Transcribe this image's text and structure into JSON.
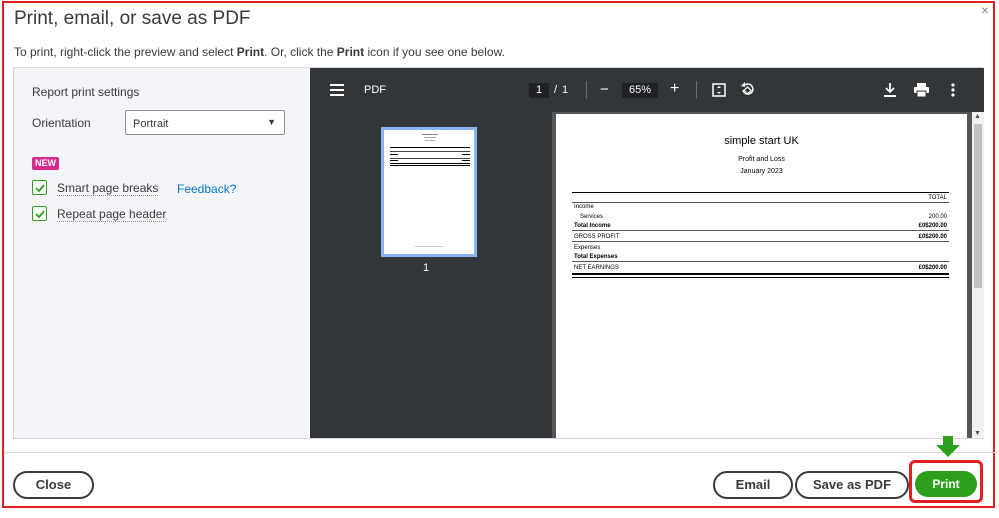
{
  "dialog": {
    "title": "Print, email, or save as PDF",
    "close_glyph": "×",
    "instruction_pre": "To print, right-click the preview and select ",
    "instruction_bold1": "Print",
    "instruction_mid": ". Or, click the ",
    "instruction_bold2": "Print",
    "instruction_post": " icon if you see one below."
  },
  "settings": {
    "heading": "Report print settings",
    "orientation_label": "Orientation",
    "orientation_value": "Portrait",
    "new_badge": "NEW",
    "smart_page_breaks": {
      "label": "Smart page breaks",
      "checked": true
    },
    "repeat_page_header": {
      "label": "Repeat page header",
      "checked": true
    },
    "feedback_link": "Feedback?"
  },
  "viewer": {
    "title": "PDF",
    "current_page": "1",
    "page_sep": "/",
    "total_pages": "1",
    "zoom": "65%",
    "zoom_out": "−",
    "zoom_in": "+",
    "thumbnail_label": "1"
  },
  "report": {
    "company": "simple start UK",
    "title": "Profit and Loss",
    "period": "January 2023",
    "column_header": "TOTAL",
    "rows": [
      {
        "label": "Income",
        "value": ""
      },
      {
        "label": "Services",
        "value": "200.00"
      },
      {
        "label": "Total Income",
        "value": "£0$200.00"
      },
      {
        "label": "GROSS PROFIT",
        "value": "£0$200.00"
      },
      {
        "label": "Expenses",
        "value": ""
      },
      {
        "label": "Total Expenses",
        "value": ""
      },
      {
        "label": "NET EARNINGS",
        "value": "£0$200.00"
      }
    ]
  },
  "footer": {
    "close_label": "Close",
    "email_label": "Email",
    "save_pdf_label": "Save as PDF",
    "print_label": "Print"
  },
  "colors": {
    "accent_green": "#2ca01c",
    "highlight_red": "#e02020",
    "badge_pink": "#d52b8c",
    "link_blue": "#0077c5"
  }
}
